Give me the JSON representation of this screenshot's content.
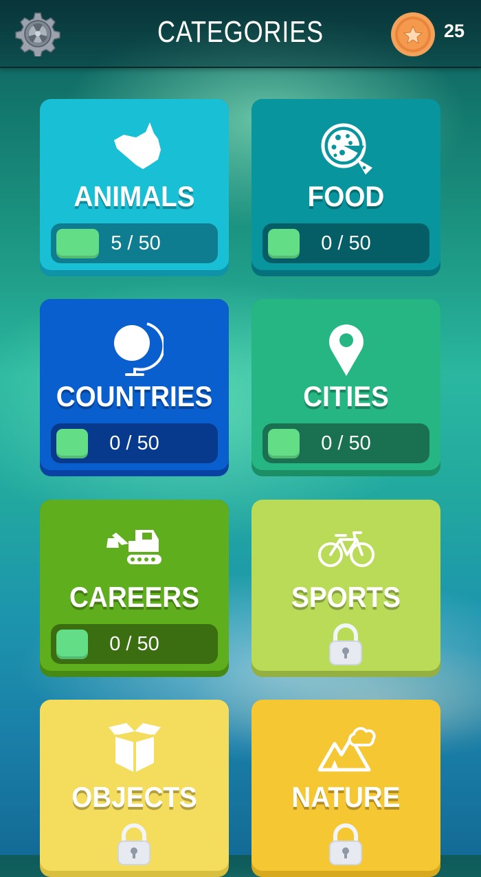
{
  "header": {
    "title": "CATEGORIES",
    "coins": "25"
  },
  "categories": [
    {
      "name": "ANIMALS",
      "icon": "cat-icon",
      "progress_text": "5 / 50",
      "completed": 5,
      "total": 50,
      "locked": false,
      "color": "#19bfd5"
    },
    {
      "name": "FOOD",
      "icon": "pizza-icon",
      "progress_text": "0 / 50",
      "completed": 0,
      "total": 50,
      "locked": false,
      "color": "#08959d"
    },
    {
      "name": "COUNTRIES",
      "icon": "globe-icon",
      "progress_text": "0 / 50",
      "completed": 0,
      "total": 50,
      "locked": false,
      "color": "#0a5fcf"
    },
    {
      "name": "CITIES",
      "icon": "map-pin-icon",
      "progress_text": "0 / 50",
      "completed": 0,
      "total": 50,
      "locked": false,
      "color": "#26b683"
    },
    {
      "name": "CAREERS",
      "icon": "excavator-icon",
      "progress_text": "0 / 50",
      "completed": 0,
      "total": 50,
      "locked": false,
      "color": "#5fae1d"
    },
    {
      "name": "SPORTS",
      "icon": "bicycle-icon",
      "locked": true,
      "color": "#b9db58"
    },
    {
      "name": "OBJECTS",
      "icon": "box-icon",
      "locked": true,
      "color": "#f4dc5c"
    },
    {
      "name": "NATURE",
      "icon": "mountain-cloud-icon",
      "locked": true,
      "color": "#f5c732"
    }
  ]
}
